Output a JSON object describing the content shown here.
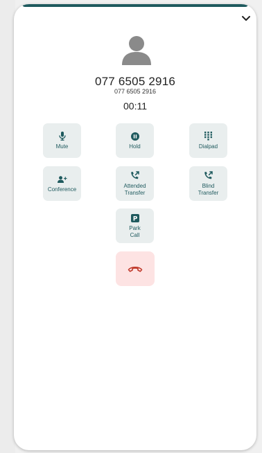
{
  "call": {
    "number_main": "077 6505 2916",
    "number_sub": "077 6505 2916",
    "timer": "00:11"
  },
  "controls": {
    "mute": "Mute",
    "hold": "Hold",
    "dialpad": "Dialpad",
    "conference": "Conference",
    "attended_transfer": "Attended\nTransfer",
    "blind_transfer": "Blind\nTransfer",
    "park_call": "Park\nCall"
  },
  "icons": {
    "collapse": "chevron-down-icon",
    "avatar": "user-avatar-icon",
    "mute": "microphone-icon",
    "hold": "pause-icon",
    "dialpad": "dialpad-grid-icon",
    "conference": "add-person-icon",
    "attended_transfer": "phone-transfer-icon",
    "blind_transfer": "phone-transfer-icon",
    "park_call": "parking-p-icon",
    "hangup": "hang-up-phone-icon"
  },
  "colors": {
    "accent": "#1f5a5e",
    "button_bg": "#e9eeee",
    "hangup_bg": "#fde3e3",
    "hangup_icon": "#c0392b",
    "avatar": "#8a8a8a"
  }
}
